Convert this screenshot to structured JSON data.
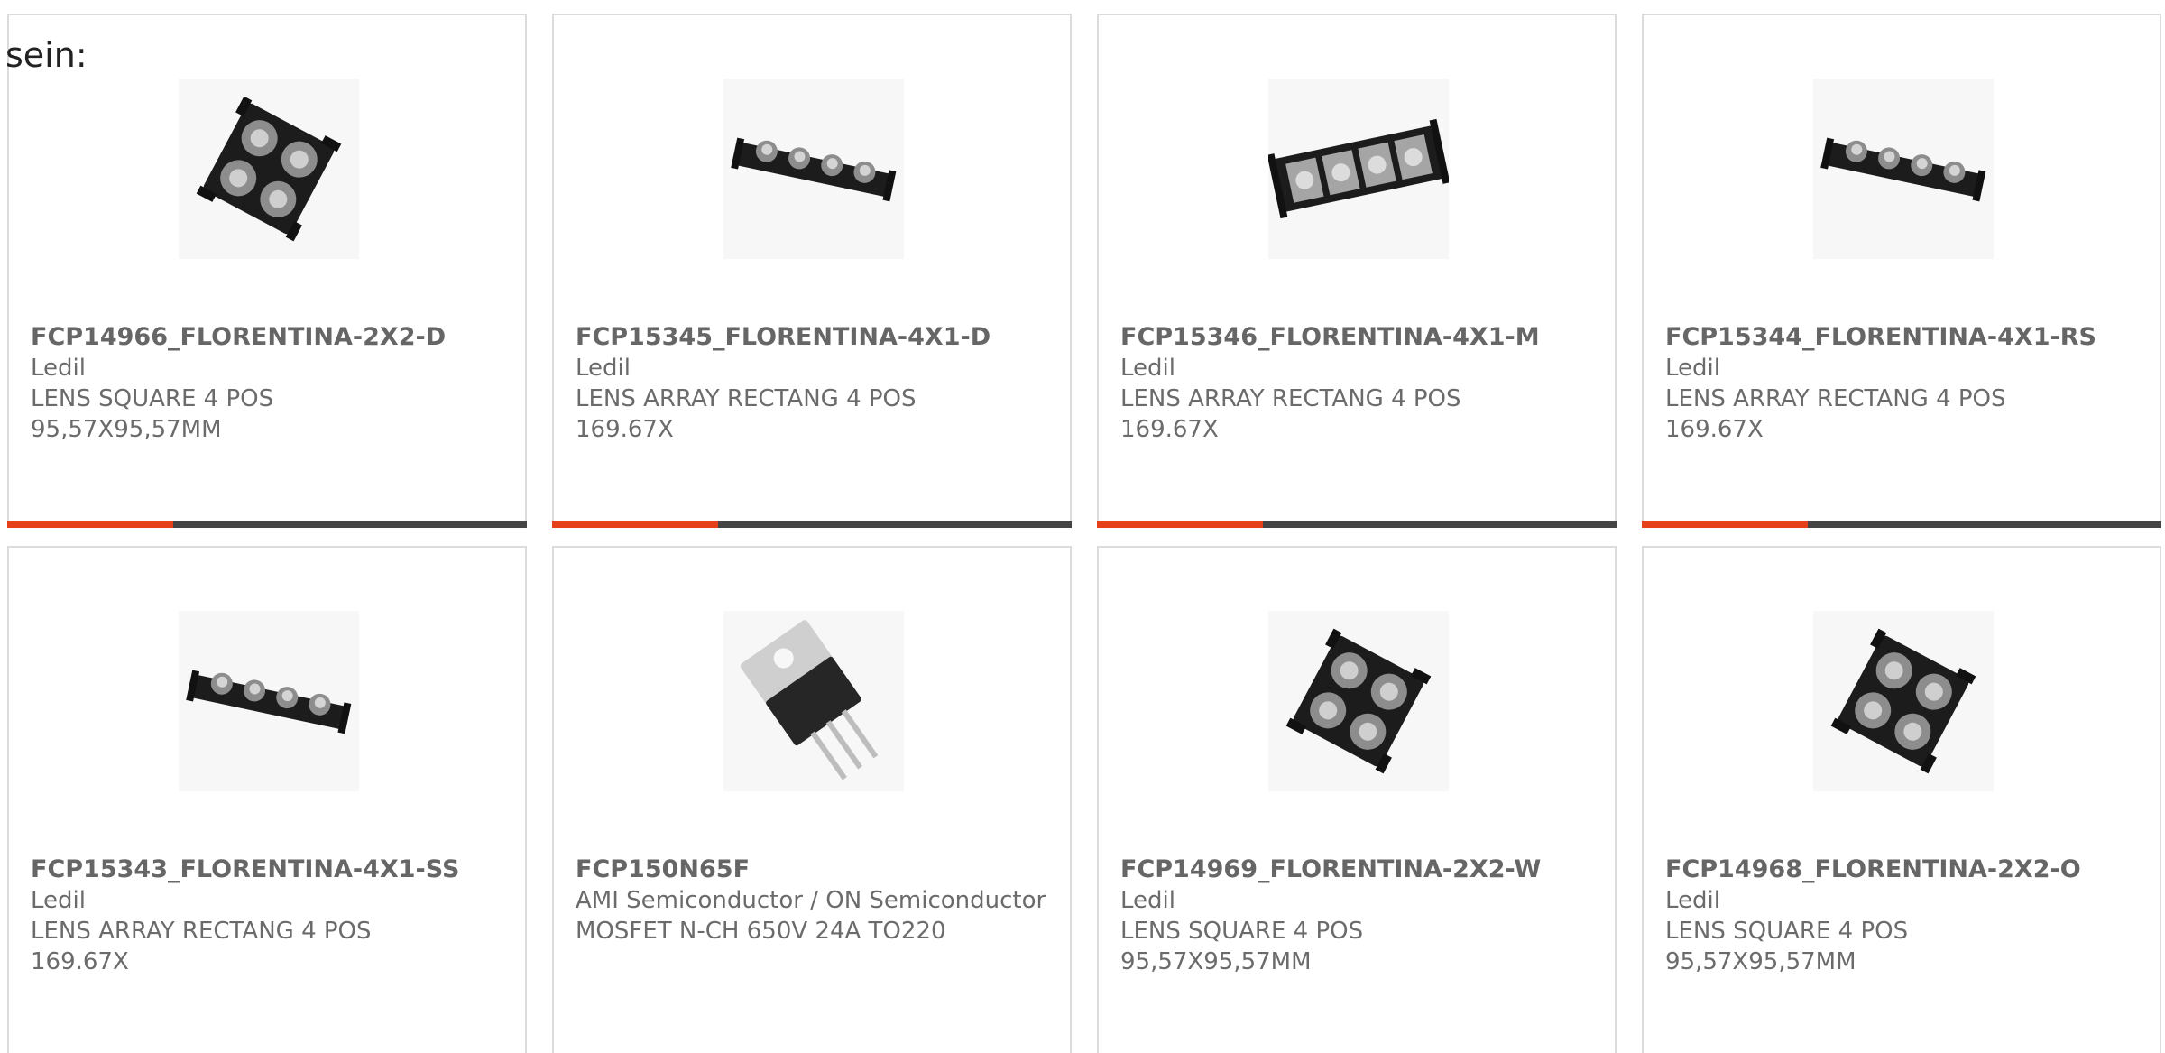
{
  "intro_text": "sein:",
  "colors": {
    "accent": "#e5401a",
    "bar": "#444444",
    "text": "#6b6b6b",
    "border": "#dcdcdc"
  },
  "products": [
    {
      "name": "FCP14966_FLORENTINA-2X2-D",
      "manufacturer": "Ledil",
      "desc1": "LENS SQUARE 4 POS",
      "desc2": "95,57X95,57MM",
      "image": "lens-square-2x2"
    },
    {
      "name": "FCP15345_FLORENTINA-4X1-D",
      "manufacturer": "Ledil",
      "desc1": "LENS ARRAY RECTANG 4 POS",
      "desc2": "169.67X",
      "image": "lens-array-4x1"
    },
    {
      "name": "FCP15346_FLORENTINA-4X1-M",
      "manufacturer": "Ledil",
      "desc1": "LENS ARRAY RECTANG 4 POS",
      "desc2": "169.67X",
      "image": "lens-array-4x1-frame"
    },
    {
      "name": "FCP15344_FLORENTINA-4X1-RS",
      "manufacturer": "Ledil",
      "desc1": "LENS ARRAY RECTANG 4 POS",
      "desc2": "169.67X",
      "image": "lens-array-4x1"
    },
    {
      "name": "FCP15343_FLORENTINA-4X1-SS",
      "manufacturer": "Ledil",
      "desc1": "LENS ARRAY RECTANG 4 POS",
      "desc2": "169.67X",
      "image": "lens-array-4x1"
    },
    {
      "name": "FCP150N65F",
      "manufacturer": "AMI Semiconductor / ON Semiconductor",
      "desc1": "MOSFET N-CH 650V 24A TO220",
      "desc2": "",
      "image": "to220-transistor"
    },
    {
      "name": "FCP14969_FLORENTINA-2X2-W",
      "manufacturer": "Ledil",
      "desc1": "LENS SQUARE 4 POS",
      "desc2": "95,57X95,57MM",
      "image": "lens-square-2x2"
    },
    {
      "name": "FCP14968_FLORENTINA-2X2-O",
      "manufacturer": "Ledil",
      "desc1": "LENS SQUARE 4 POS",
      "desc2": "95,57X95,57MM",
      "image": "lens-square-2x2"
    }
  ]
}
